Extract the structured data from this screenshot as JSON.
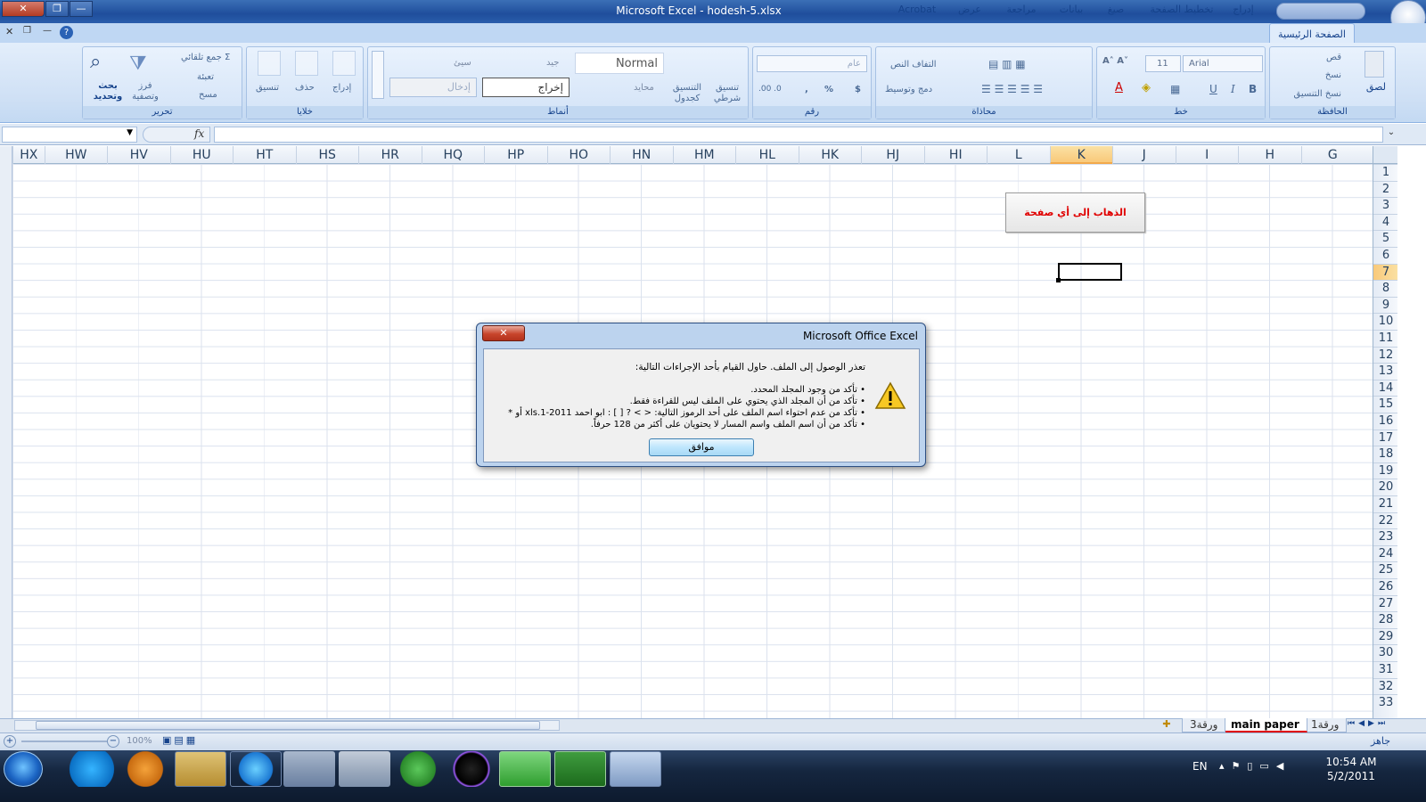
{
  "window": {
    "title": "Microsoft Excel - hodesh-5.xlsx",
    "close": "✕",
    "restore": "❐",
    "minimize": "—"
  },
  "ribbon_tabs": [
    "الصفحة الرئيسية",
    "إدراج",
    "تخطيط الصفحة",
    "صيغ",
    "بيانات",
    "مراجعة",
    "عرض",
    "Acrobat"
  ],
  "groups": {
    "clipboard": {
      "label": "الحافظة",
      "paste": "لصق",
      "cut": "قص",
      "copy": "نسخ",
      "format_painter": "نسخ التنسيق"
    },
    "font": {
      "label": "خط",
      "font_name": "Arial",
      "font_size": "11",
      "bold": "B",
      "italic": "I",
      "underline": "U"
    },
    "alignment": {
      "label": "محاذاة",
      "wrap": "التفاف النص",
      "merge": "دمج وتوسيط"
    },
    "number": {
      "label": "رقم",
      "format": "عام",
      "currency": "$",
      "percent": "%",
      "comma": ","
    },
    "styles": {
      "label": "أنماط",
      "conditional": "تنسيق شرطي",
      "as_table": "التنسيق كجدول",
      "normal": "Normal",
      "good": "جيد",
      "bad": "سيئ",
      "neutral": "محايد",
      "output": "إخراج",
      "input": "إدخال"
    },
    "cells": {
      "label": "خلايا",
      "insert": "إدراج",
      "delete": "حذف",
      "format": "تنسيق"
    },
    "editing": {
      "label": "تحرير",
      "autosum": "جمع تلقائي",
      "fill": "تعبئة",
      "clear": "مسح",
      "sort": "فرز وتصفية",
      "find": "بحث وتحديد"
    }
  },
  "formula": {
    "fx": "fx"
  },
  "columns": [
    "HX",
    "HW",
    "HV",
    "HU",
    "HT",
    "HS",
    "HR",
    "HQ",
    "HP",
    "HO",
    "HN",
    "HM",
    "HL",
    "HK",
    "HJ",
    "HI",
    "L",
    "K",
    "J",
    "I",
    "H",
    "G"
  ],
  "selected_column": "K",
  "rows": [
    "1",
    "2",
    "3",
    "4",
    "5",
    "6",
    "7",
    "8",
    "9",
    "10",
    "11",
    "12",
    "13",
    "14",
    "15",
    "16",
    "17",
    "18",
    "19",
    "20",
    "21",
    "22",
    "23",
    "24",
    "25",
    "26",
    "27",
    "28",
    "29",
    "30",
    "31",
    "32",
    "33"
  ],
  "selected_row": "7",
  "goto_button": "الذهاب إلى أي صفحة",
  "dialog": {
    "title": "Microsoft Office Excel",
    "close": "✕",
    "intro": "تعذر الوصول إلى الملف. حاول القيام بأحد الإجراءات التالية:",
    "items": [
      "• تأكد من وجود المجلد المحدد.",
      "• تأكد من أن المجلد الذي يحتوي على الملف ليس للقراءة فقط.",
      "• تأكد من عدم احتواء اسم الملف على أحد الرموز التالية: < > ? [ ] : ابو احمد xls.1-2011 أو *",
      "• تأكد من أن اسم الملف واسم المسار لا يحتويان على أكثر من 128 حرفاً."
    ],
    "ok": "موافق"
  },
  "sheets": [
    "ورقة1",
    "main paper",
    "ورقة3"
  ],
  "active_sheet": "main paper",
  "status": {
    "ready": "جاهز",
    "zoom": "100%"
  },
  "taskbar": {
    "lang": "EN",
    "time": "10:54 AM",
    "date": "5/2/2011"
  }
}
